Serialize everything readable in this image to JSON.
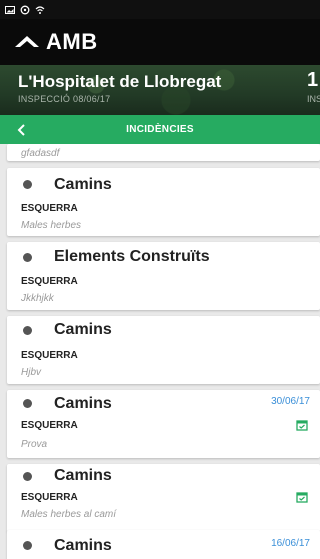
{
  "status_bar": {
    "icons": [
      "image-icon",
      "sync-icon",
      "wifi-icon"
    ]
  },
  "app_bar": {
    "logo_text": "AMB"
  },
  "hero": {
    "title": "L'Hospitalet de Llobregat",
    "subtitle": "INSPECCIÓ 08/06/17",
    "peek_number": "1",
    "peek_sub": "INS"
  },
  "section": {
    "title": "INCIDÈNCIES"
  },
  "colors": {
    "accent_green": "#26ab61",
    "date_blue": "#3a8fd8",
    "dark_bar": "#0a0a0a"
  },
  "incidents": {
    "partial_desc": "gfadasdf",
    "items": [
      {
        "category": "Camins",
        "side": "ESQUERRA",
        "description": "Males herbes",
        "date": "",
        "has_calendar": false
      },
      {
        "category": "Elements Construïts",
        "side": "ESQUERRA",
        "description": "Jkkhjkk",
        "date": "",
        "has_calendar": false
      },
      {
        "category": "Camins",
        "side": "ESQUERRA",
        "description": "Hjbv",
        "date": "",
        "has_calendar": false
      },
      {
        "category": "Camins",
        "side": "ESQUERRA",
        "description": "Prova",
        "date": "30/06/17",
        "has_calendar": true
      },
      {
        "category": "Camins",
        "side": "ESQUERRA",
        "description": "Males herbes al camí",
        "date": "",
        "has_calendar": true
      },
      {
        "category": "Camins",
        "side": "",
        "description": "",
        "date": "16/06/17",
        "has_calendar": false
      }
    ]
  }
}
